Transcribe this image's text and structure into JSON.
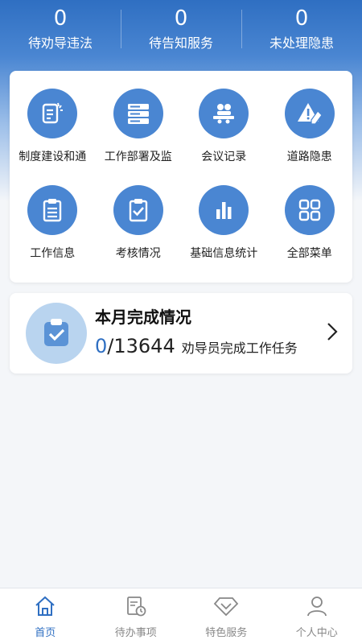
{
  "stats": [
    {
      "value": "0",
      "label": "待劝导违法"
    },
    {
      "value": "0",
      "label": "待告知服务"
    },
    {
      "value": "0",
      "label": "未处理隐患"
    }
  ],
  "menu": [
    {
      "label": "制度建设和通",
      "icon": "document-edit-icon"
    },
    {
      "label": "工作部署及监",
      "icon": "server-stack-icon"
    },
    {
      "label": "会议记录",
      "icon": "meeting-people-icon"
    },
    {
      "label": "道路隐患",
      "icon": "warning-pen-icon"
    },
    {
      "label": "工作信息",
      "icon": "clipboard-list-icon"
    },
    {
      "label": "考核情况",
      "icon": "clipboard-check-icon"
    },
    {
      "label": "基础信息统计",
      "icon": "bar-chart-icon"
    },
    {
      "label": "全部菜单",
      "icon": "grid-icon"
    }
  ],
  "monthly": {
    "title": "本月完成情况",
    "done": "0",
    "total": "/13644",
    "desc": "劝导员完成工作任务"
  },
  "tabs": [
    {
      "label": "首页",
      "icon": "home-icon",
      "active": true
    },
    {
      "label": "待办事项",
      "icon": "todo-clock-icon",
      "active": false
    },
    {
      "label": "特色服务",
      "icon": "diamond-icon",
      "active": false
    },
    {
      "label": "个人中心",
      "icon": "person-icon",
      "active": false
    }
  ],
  "colors": {
    "accent": "#2f6fc2",
    "icon_bg": "#4a86d2"
  }
}
